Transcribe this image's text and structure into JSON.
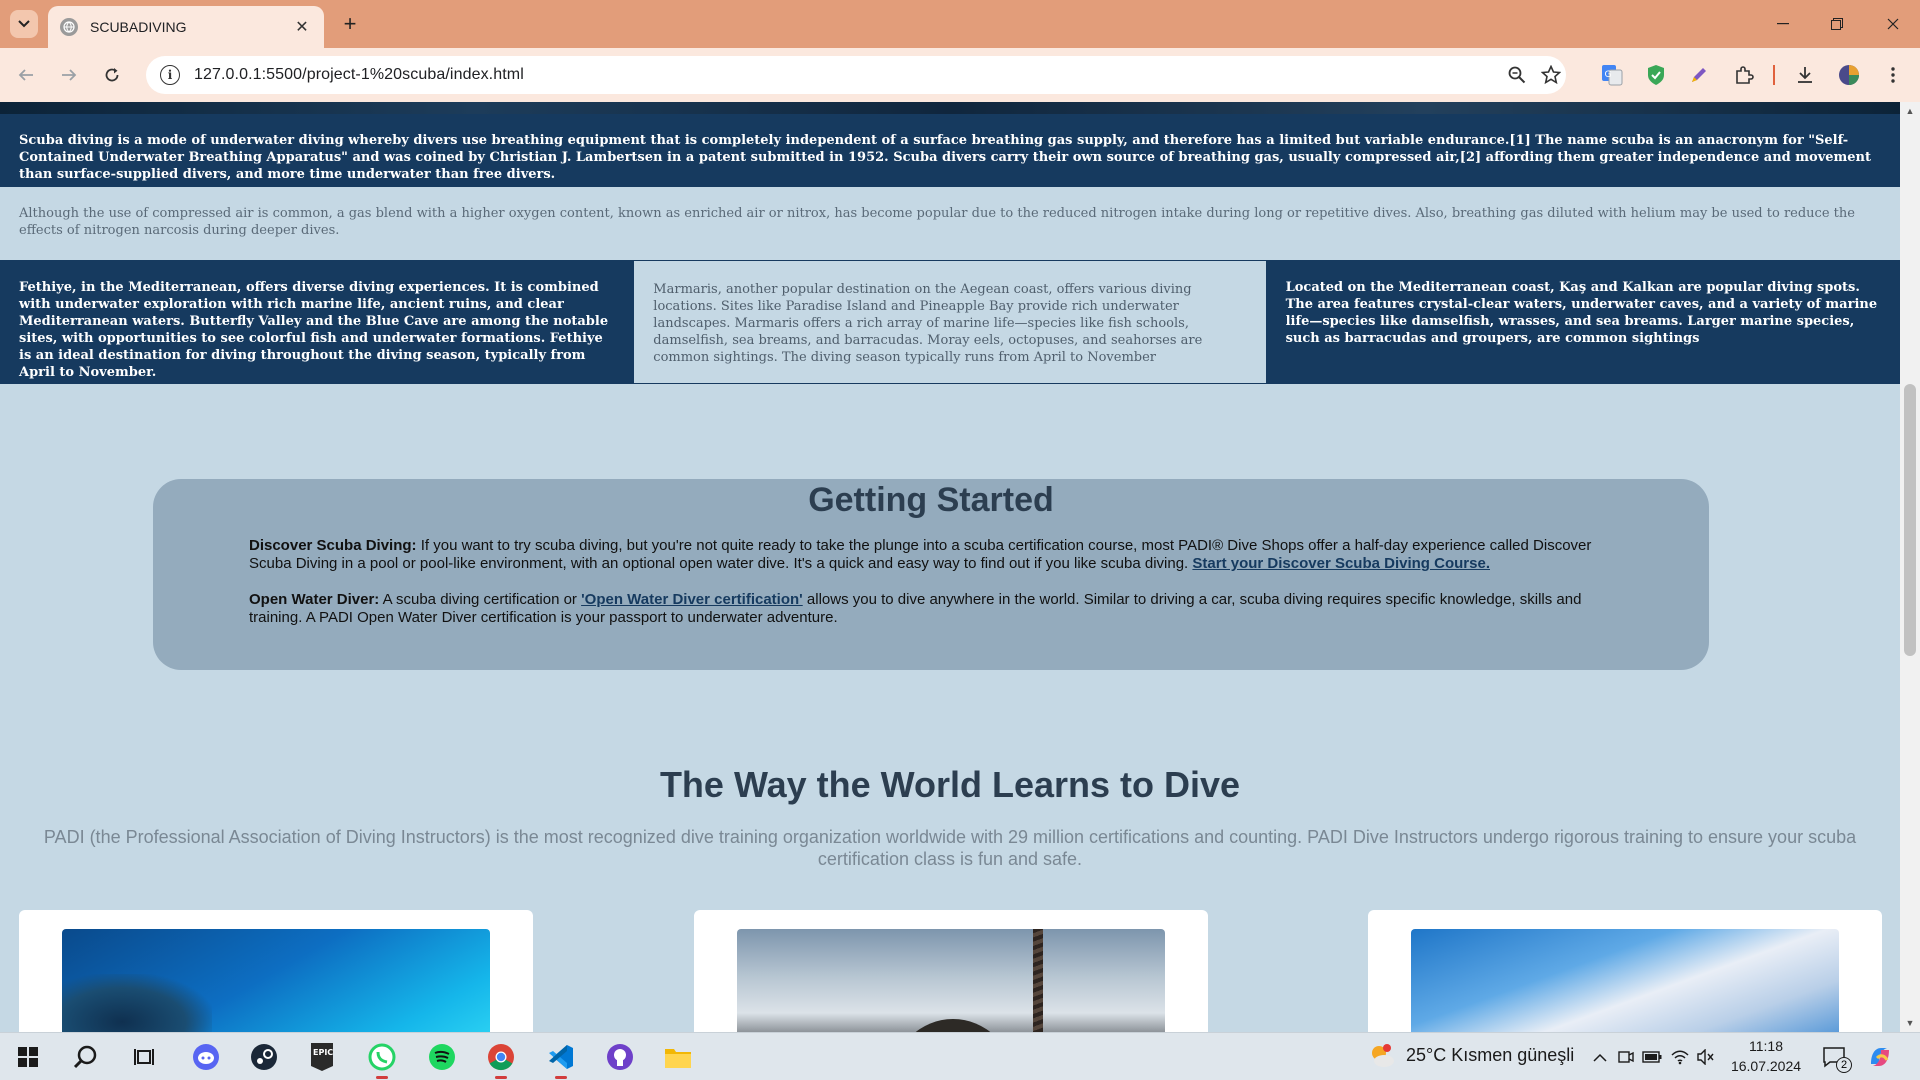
{
  "browser": {
    "tab_title": "SCUBADIVING",
    "url": "127.0.0.1:5500/project-1%20scuba/index.html",
    "new_tab_symbol": "+",
    "close_symbol": "✕"
  },
  "page": {
    "intro_dark": "Scuba diving is a mode of underwater diving whereby divers use breathing equipment that is completely independent of a surface breathing gas supply, and therefore has a limited but variable endurance.[1] The name scuba is an anacronym for \"Self-Contained Underwater Breathing Apparatus\" and was coined by Christian J. Lambertsen in a patent submitted in 1952. Scuba divers carry their own source of breathing gas, usually compressed air,[2] affording them greater independence and movement than surface-supplied divers, and more time underwater than free divers.",
    "intro_light": "Although the use of compressed air is common, a gas blend with a higher oxygen content, known as enriched air or nitrox, has become popular due to the reduced nitrogen intake during long or repetitive dives. Also, breathing gas diluted with helium may be used to reduce the effects of nitrogen narcosis during deeper dives.",
    "columns": [
      "Fethiye, in the Mediterranean, offers diverse diving experiences. It is combined with underwater exploration with rich marine life, ancient ruins, and clear Mediterranean waters. Butterfly Valley and the Blue Cave are among the notable sites, with opportunities to see colorful fish and underwater formations. Fethiye is an ideal destination for diving throughout the diving season, typically from April to November.",
      "Marmaris, another popular destination on the Aegean coast, offers various diving locations. Sites like Paradise Island and Pineapple Bay provide rich underwater landscapes. Marmaris offers a rich array of marine life—species like fish schools, damselfish, sea breams, and barracudas. Moray eels, octopuses, and seahorses are common sightings. The diving season typically runs from April to November",
      "Located on the Mediterranean coast, Kaş and Kalkan are popular diving spots. The area features crystal-clear waters, underwater caves, and a variety of marine life—species like damselfish, wrasses, and sea breams. Larger marine species, such as barracudas and groupers, are common sightings"
    ],
    "getting_started": {
      "title": "Getting Started",
      "p1_label": "Discover Scuba Diving:",
      "p1_text": " If you want to try scuba diving, but you're not quite ready to take the plunge into a scuba certification course, most PADI® Dive Shops offer a half-day experience called Discover Scuba Diving in a pool or pool-like environment, with an optional open water dive. It's a quick and easy way to find out if you like scuba diving. ",
      "p1_link": "Start your Discover Scuba Diving Course.",
      "p2_label": "Open Water Diver:",
      "p2_text_a": " A scuba diving certification or ",
      "p2_link": "'Open Water Diver certification'",
      "p2_text_b": " allows you to dive anywhere in the world. Similar to driving a car, scuba diving requires specific knowledge, skills and training. A PADI Open Water Diver certification is your passport to underwater adventure."
    },
    "world": {
      "title": "The Way the World Learns to Dive",
      "desc": "PADI (the Professional Association of Diving Instructors) is the most recognized dive training organization worldwide with 29 million certifications and counting. PADI Dive Instructors undergo rigorous training to ensure your scuba certification class is fun and safe."
    }
  },
  "taskbar": {
    "weather": "25°C  Kısmen güneşli",
    "time": "11:18",
    "date": "16.07.2024",
    "notifications": "2"
  },
  "colors": {
    "navy": "#163a5f",
    "page_bg": "#c5d8e4",
    "box_bg": "#94abbd",
    "chrome_tab": "#e29d7a"
  }
}
